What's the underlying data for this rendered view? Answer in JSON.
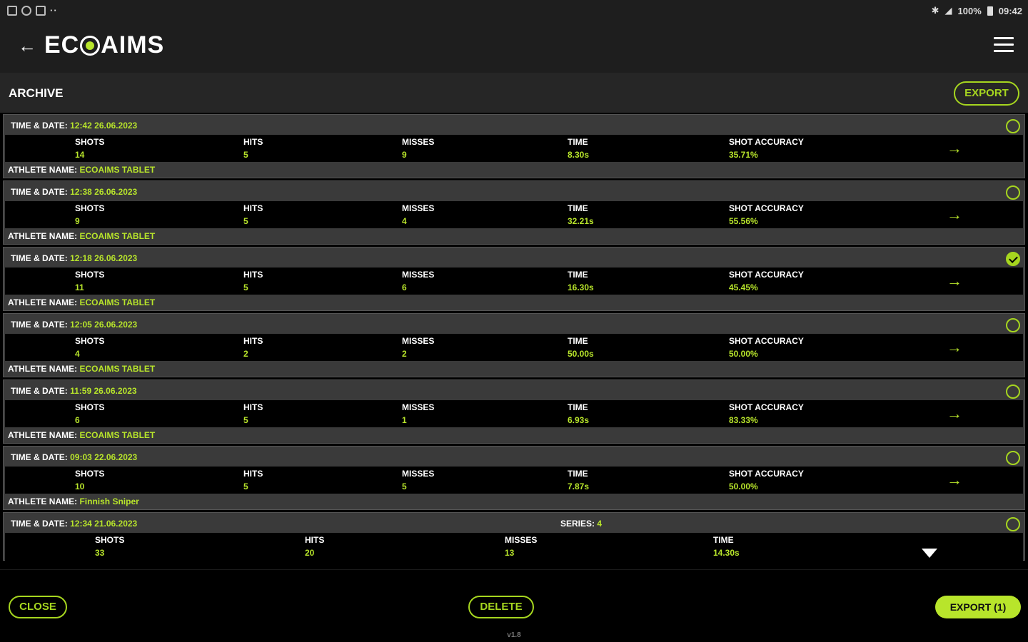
{
  "statusbar": {
    "left_icons": [
      "image-icon",
      "settings-icon",
      "mail-icon"
    ],
    "dots": "··",
    "signal": "100%",
    "time": "09:42"
  },
  "header": {
    "logo_text_left": "EC",
    "logo_text_right": "AIMS",
    "back_icon": "arrow-left-icon",
    "menu_icon": "hamburger-icon"
  },
  "title": {
    "label": "ARCHIVE",
    "export_label": "EXPORT"
  },
  "labels": {
    "time_date": "TIME & DATE:",
    "shots": "SHOTS",
    "hits": "HITS",
    "misses": "MISSES",
    "time": "TIME",
    "shot_accuracy": "SHOT ACCURACY",
    "athlete_name": "ATHLETE NAME:",
    "series": "SERIES:"
  },
  "records": [
    {
      "datetime": "12:42 26.06.2023",
      "shots": "14",
      "hits": "5",
      "misses": "9",
      "time": "8.30s",
      "accuracy": "35.71%",
      "athlete": "ECOAIMS TABLET",
      "selected": false
    },
    {
      "datetime": "12:38 26.06.2023",
      "shots": "9",
      "hits": "5",
      "misses": "4",
      "time": "32.21s",
      "accuracy": "55.56%",
      "athlete": "ECOAIMS TABLET",
      "selected": false
    },
    {
      "datetime": "12:18 26.06.2023",
      "shots": "11",
      "hits": "5",
      "misses": "6",
      "time": "16.30s",
      "accuracy": "45.45%",
      "athlete": "ECOAIMS TABLET",
      "selected": true
    },
    {
      "datetime": "12:05 26.06.2023",
      "shots": "4",
      "hits": "2",
      "misses": "2",
      "time": "50.00s",
      "accuracy": "50.00%",
      "athlete": "ECOAIMS TABLET",
      "selected": false
    },
    {
      "datetime": "11:59 26.06.2023",
      "shots": "6",
      "hits": "5",
      "misses": "1",
      "time": "6.93s",
      "accuracy": "83.33%",
      "athlete": "ECOAIMS TABLET",
      "selected": false
    },
    {
      "datetime": "09:03 22.06.2023",
      "shots": "10",
      "hits": "5",
      "misses": "5",
      "time": "7.87s",
      "accuracy": "50.00%",
      "athlete": "Finnish Sniper",
      "selected": false
    }
  ],
  "series_record": {
    "datetime": "12:34 21.06.2023",
    "series": "4",
    "shots": "33",
    "hits": "20",
    "misses": "13",
    "time": "14.30s",
    "selected": false
  },
  "bottom": {
    "close_label": "CLOSE",
    "delete_label": "DELETE",
    "export_selected_label": "EXPORT (1)",
    "version": "v1.8"
  },
  "colors": {
    "accent": "#b8e52b",
    "background": "#000000",
    "card": "#3a3a3a"
  }
}
